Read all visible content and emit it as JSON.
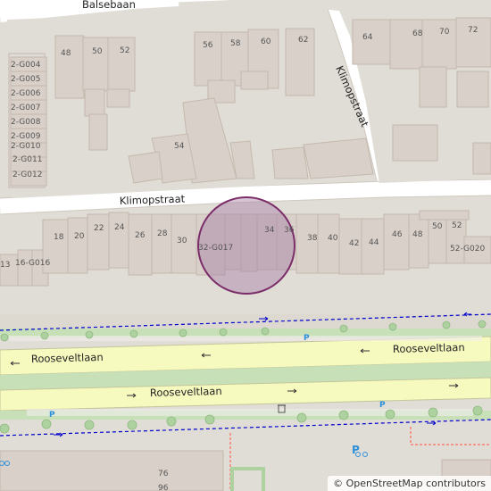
{
  "colors": {
    "background": "#e0dcd6",
    "building": "#d9d0c9",
    "building_stroke": "#c4b9ad",
    "road": "#ffffff",
    "road_stroke": "#cfc8be",
    "primary_road": "#f7fabf",
    "median": "#c8e0b8",
    "tree": "#aed1a0",
    "parking": "#2c8fd9",
    "cycleway": "#0000cc",
    "footway": "#fa8072",
    "marker_fill": "#a67fa6",
    "marker_stroke": "#7b2d6a"
  },
  "streets": {
    "balsebaan": "Balsebaan",
    "klimopstraat_horizontal": "Klimopstraat",
    "klimopstraat_vertical": "Klimopstraat",
    "rooseveltlaan_top_left": "Rooseveltlaan",
    "rooseveltlaan_top_right": "Rooseveltlaan",
    "rooseveltlaan_bottom": "Rooseveltlaan"
  },
  "house_numbers": {
    "h48": "48",
    "h50": "50",
    "h52a": "52",
    "h56": "56",
    "h58": "58",
    "h60": "60",
    "h62": "62",
    "h64": "64",
    "h68": "68",
    "h70": "70",
    "h72": "72",
    "h54": "54",
    "g004": "2-G004",
    "g005": "2-G005",
    "g006": "2-G006",
    "g007": "2-G007",
    "g008": "2-G008",
    "g009": "2-G009",
    "g010": "2-G010",
    "g011": "2-G011",
    "g012": "2-G012",
    "h18": "18",
    "h20": "20",
    "h22": "22",
    "h24": "24",
    "h26": "26",
    "h28": "28",
    "h30": "30",
    "g017": "32-G017",
    "h34": "34",
    "h36": "36",
    "h38": "38",
    "h40": "40",
    "h42": "42",
    "h44": "44",
    "h46": "46",
    "h48b": "48",
    "h50b": "50",
    "h52b": "52",
    "g020": "52-G020",
    "g016": "16-G016",
    "h13": "13",
    "h76": "76",
    "h96": "96"
  },
  "poi": {
    "parking_label": "P",
    "waste_icon": "waste-basket-icon",
    "bicycle_parking_icon": "bicycle-parking-icon"
  },
  "attribution": "© OpenStreetMap contributors"
}
